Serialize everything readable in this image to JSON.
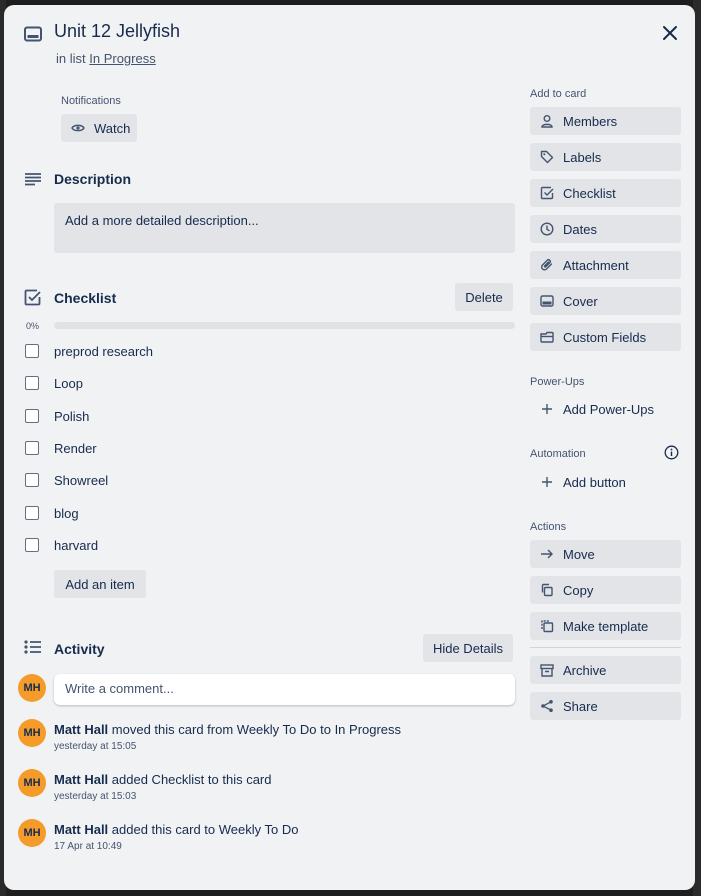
{
  "card": {
    "title": "Unit 12 Jellyfish",
    "in_list_prefix": "in list",
    "list_name": "In Progress"
  },
  "notifications": {
    "label": "Notifications",
    "watch_label": "Watch"
  },
  "description": {
    "title": "Description",
    "placeholder": "Add a more detailed description..."
  },
  "checklist": {
    "title": "Checklist",
    "delete_label": "Delete",
    "progress_text": "0%",
    "progress_value": 0,
    "items": [
      {
        "label": "preprod research",
        "checked": false
      },
      {
        "label": "Loop",
        "checked": false
      },
      {
        "label": "Polish",
        "checked": false
      },
      {
        "label": "Render",
        "checked": false
      },
      {
        "label": "Showreel",
        "checked": false
      },
      {
        "label": "blog",
        "checked": false
      },
      {
        "label": "harvard",
        "checked": false
      }
    ],
    "add_item_label": "Add an item"
  },
  "activity": {
    "title": "Activity",
    "hide_details_label": "Hide Details",
    "comment_placeholder": "Write a comment...",
    "avatar_initials": "MH",
    "entries": [
      {
        "user": "Matt Hall",
        "action": "moved this card from Weekly To Do to In Progress",
        "time": "yesterday at 15:05"
      },
      {
        "user": "Matt Hall",
        "action": "added Checklist to this card",
        "time": "yesterday at 15:03"
      },
      {
        "user": "Matt Hall",
        "action": "added this card to Weekly To Do",
        "time": "17 Apr at 10:49"
      }
    ]
  },
  "sidebar": {
    "add_to_card_label": "Add to card",
    "add_to_card": [
      {
        "label": "Members",
        "icon": "person-icon"
      },
      {
        "label": "Labels",
        "icon": "tag-icon"
      },
      {
        "label": "Checklist",
        "icon": "checkbox-icon"
      },
      {
        "label": "Dates",
        "icon": "clock-icon"
      },
      {
        "label": "Attachment",
        "icon": "paperclip-icon"
      },
      {
        "label": "Cover",
        "icon": "card-cover-icon"
      },
      {
        "label": "Custom Fields",
        "icon": "custom-fields-icon"
      }
    ],
    "powerups_label": "Power-Ups",
    "add_powerups_label": "Add Power-Ups",
    "automation_label": "Automation",
    "add_button_label": "Add button",
    "actions_label": "Actions",
    "actions": [
      {
        "label": "Move",
        "icon": "arrow-right-icon"
      },
      {
        "label": "Copy",
        "icon": "copy-icon"
      },
      {
        "label": "Make template",
        "icon": "template-icon"
      },
      {
        "label": "Archive",
        "icon": "archive-icon"
      },
      {
        "label": "Share",
        "icon": "share-icon"
      }
    ]
  },
  "colors": {
    "modal_bg": "#f1f2f4",
    "button_bg": "#e2e4e8",
    "text": "#172b4d",
    "subtle_text": "#44546f",
    "avatar": "#f49b2a"
  }
}
